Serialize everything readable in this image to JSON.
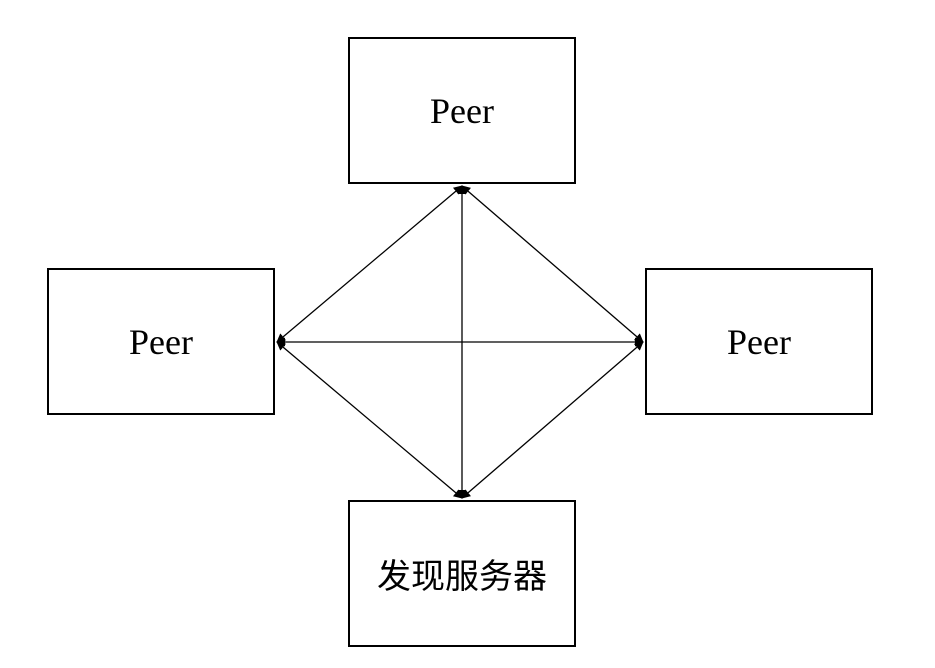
{
  "diagram": {
    "nodes": [
      {
        "id": "top",
        "label": "Peer"
      },
      {
        "id": "left",
        "label": "Peer"
      },
      {
        "id": "right",
        "label": "Peer"
      },
      {
        "id": "bottom",
        "label": "发现服务器"
      }
    ],
    "edges": [
      {
        "from": "top",
        "to": "left"
      },
      {
        "from": "top",
        "to": "right"
      },
      {
        "from": "top",
        "to": "bottom"
      },
      {
        "from": "left",
        "to": "right"
      },
      {
        "from": "left",
        "to": "bottom"
      },
      {
        "from": "right",
        "to": "bottom"
      }
    ],
    "line_color": "#000000",
    "arrowheads": "both-ends"
  }
}
